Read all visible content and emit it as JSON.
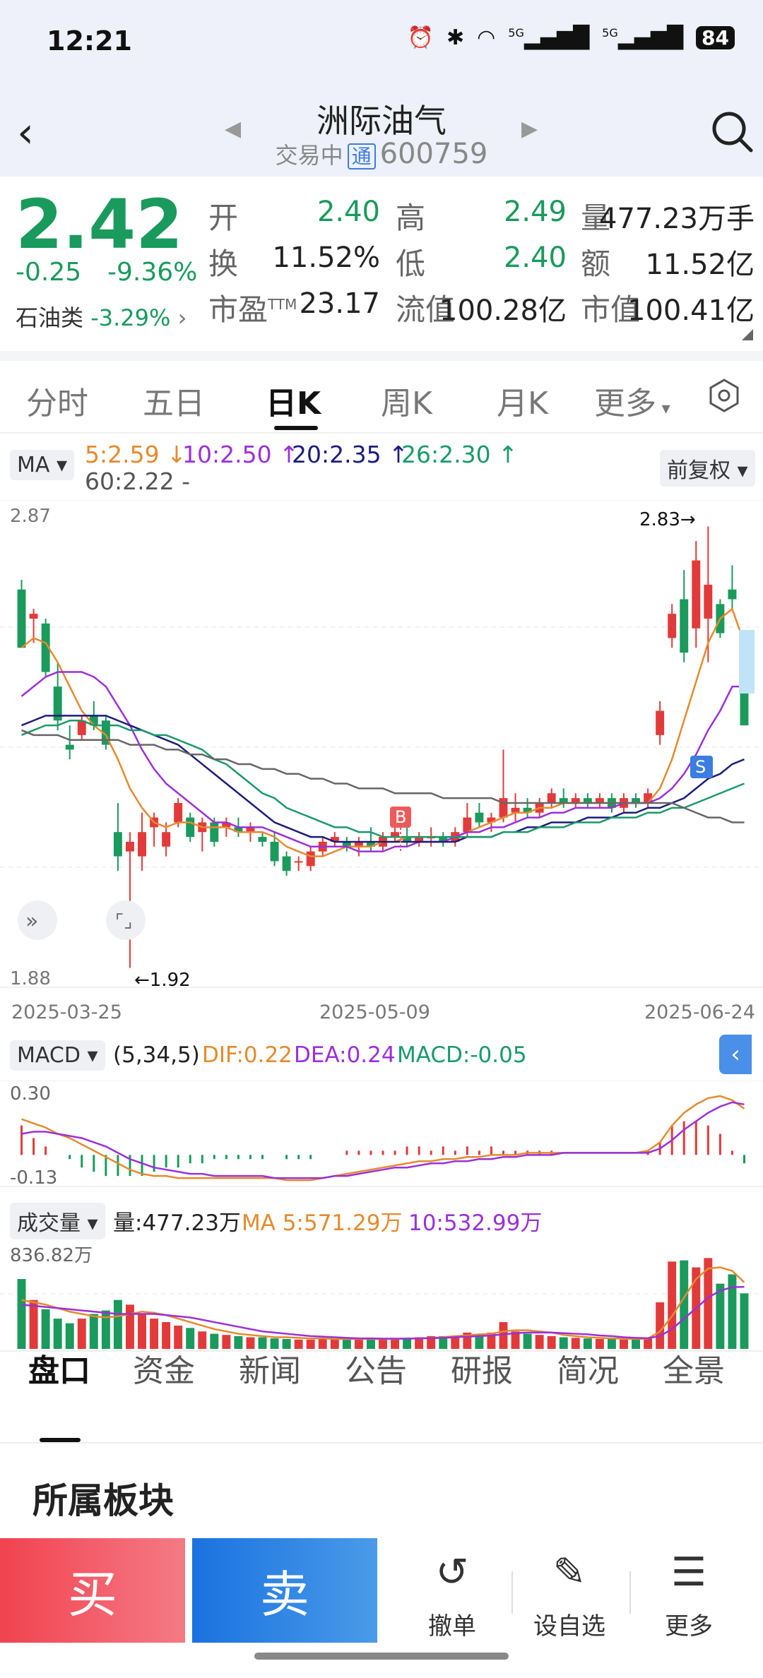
{
  "status_bar": {
    "time": "12:21",
    "battery": "84",
    "net1": "5G",
    "net2": "5G"
  },
  "header": {
    "title": "洲际油气",
    "trading_status": "交易中",
    "tong_badge": "通",
    "code": "600759"
  },
  "quote": {
    "price": "2.42",
    "change": "-0.25",
    "change_pct": "-9.36%",
    "sector_name": "石油类",
    "sector_pct": "-3.29%",
    "fields": [
      {
        "label": "开",
        "value": "2.40",
        "color": "green"
      },
      {
        "label": "高",
        "value": "2.49",
        "color": "green"
      },
      {
        "label": "量",
        "value": "477.23万手",
        "color": "dark"
      },
      {
        "label": "换",
        "value": "11.52%",
        "color": "dark"
      },
      {
        "label": "低",
        "value": "2.40",
        "color": "green"
      },
      {
        "label": "额",
        "value": "11.52亿",
        "color": "dark"
      },
      {
        "label": "市盈TTM",
        "value": "23.17",
        "color": "dark"
      },
      {
        "label": "流值",
        "value": "100.28亿",
        "color": "dark"
      },
      {
        "label": "市值",
        "value": "100.41亿",
        "color": "dark"
      }
    ]
  },
  "chart_tabs": [
    "分时",
    "五日",
    "日K",
    "周K",
    "月K",
    "更多"
  ],
  "chart_tabs_active": 2,
  "ma_legend": {
    "selector": "MA",
    "items": [
      {
        "text": "5:2.59 ↓",
        "color": "#e58a2e"
      },
      {
        "text": "10:2.50 ↑",
        "color": "#9b30d9"
      },
      {
        "text": "20:2.35 ↑",
        "color": "#1b1e7a"
      },
      {
        "text": "26:2.30 ↑",
        "color": "#1a9a6a"
      },
      {
        "text": "60:2.22 -",
        "color": "#555555"
      }
    ],
    "adjust": "前复权"
  },
  "kline_axis": {
    "top": "2.87",
    "bottom": "1.88",
    "high_label": "2.83→",
    "low_label": "←1.92",
    "dates": [
      "2025-03-25",
      "2025-05-09",
      "2025-06-24"
    ],
    "buy_marker": "B",
    "sell_marker": "S"
  },
  "macd": {
    "selector": "MACD",
    "params": "(5,34,5)",
    "dif": "DIF:0.22",
    "dea": "DEA:0.24",
    "macd": "MACD:-0.05",
    "top": "0.30",
    "bottom": "-0.13"
  },
  "volume": {
    "selector": "成交量",
    "vol": "量:477.23万",
    "ma5": "MA 5:571.29万",
    "ma10": "10:532.99万",
    "top": "836.82万"
  },
  "colors": {
    "up": "#e23a3a",
    "down": "#1a9a5c",
    "ma5": "#e58a2e",
    "ma10": "#9b30d9",
    "ma20": "#1b1e7a",
    "ma26": "#1a9a6a",
    "ma60": "#666666"
  },
  "chart_data": {
    "type": "candlestick",
    "x_range": [
      "2025-03-25",
      "2025-06-24"
    ],
    "ylim": [
      1.88,
      2.87
    ],
    "candles": [
      {
        "o": 2.7,
        "h": 2.72,
        "l": 2.58,
        "c": 2.58
      },
      {
        "o": 2.64,
        "h": 2.66,
        "l": 2.59,
        "c": 2.65
      },
      {
        "o": 2.63,
        "h": 2.64,
        "l": 2.52,
        "c": 2.53
      },
      {
        "o": 2.5,
        "h": 2.55,
        "l": 2.41,
        "c": 2.43
      },
      {
        "o": 2.38,
        "h": 2.42,
        "l": 2.35,
        "c": 2.37
      },
      {
        "o": 2.4,
        "h": 2.44,
        "l": 2.39,
        "c": 2.43
      },
      {
        "o": 2.44,
        "h": 2.47,
        "l": 2.41,
        "c": 2.42
      },
      {
        "o": 2.43,
        "h": 2.44,
        "l": 2.37,
        "c": 2.38
      },
      {
        "o": 2.2,
        "h": 2.26,
        "l": 2.12,
        "c": 2.15
      },
      {
        "o": 2.16,
        "h": 2.2,
        "l": 1.92,
        "c": 2.18
      },
      {
        "o": 2.15,
        "h": 2.24,
        "l": 2.12,
        "c": 2.2
      },
      {
        "o": 2.21,
        "h": 2.24,
        "l": 2.17,
        "c": 2.23
      },
      {
        "o": 2.17,
        "h": 2.22,
        "l": 2.15,
        "c": 2.2
      },
      {
        "o": 2.22,
        "h": 2.27,
        "l": 2.21,
        "c": 2.26
      },
      {
        "o": 2.23,
        "h": 2.24,
        "l": 2.18,
        "c": 2.19
      },
      {
        "o": 2.2,
        "h": 2.23,
        "l": 2.16,
        "c": 2.22
      },
      {
        "o": 2.22,
        "h": 2.23,
        "l": 2.17,
        "c": 2.18
      },
      {
        "o": 2.21,
        "h": 2.23,
        "l": 2.19,
        "c": 2.22
      },
      {
        "o": 2.21,
        "h": 2.23,
        "l": 2.19,
        "c": 2.2
      },
      {
        "o": 2.2,
        "h": 2.22,
        "l": 2.18,
        "c": 2.21
      },
      {
        "o": 2.19,
        "h": 2.2,
        "l": 2.17,
        "c": 2.18
      },
      {
        "o": 2.18,
        "h": 2.2,
        "l": 2.13,
        "c": 2.14
      },
      {
        "o": 2.15,
        "h": 2.16,
        "l": 2.11,
        "c": 2.12
      },
      {
        "o": 2.14,
        "h": 2.15,
        "l": 2.12,
        "c": 2.14
      },
      {
        "o": 2.13,
        "h": 2.17,
        "l": 2.12,
        "c": 2.16
      },
      {
        "o": 2.16,
        "h": 2.19,
        "l": 2.15,
        "c": 2.18
      },
      {
        "o": 2.18,
        "h": 2.2,
        "l": 2.17,
        "c": 2.19
      },
      {
        "o": 2.18,
        "h": 2.19,
        "l": 2.16,
        "c": 2.17
      },
      {
        "o": 2.17,
        "h": 2.19,
        "l": 2.15,
        "c": 2.18
      },
      {
        "o": 2.18,
        "h": 2.21,
        "l": 2.16,
        "c": 2.17
      },
      {
        "o": 2.17,
        "h": 2.2,
        "l": 2.16,
        "c": 2.19
      },
      {
        "o": 2.19,
        "h": 2.21,
        "l": 2.18,
        "c": 2.2
      },
      {
        "o": 2.19,
        "h": 2.21,
        "l": 2.17,
        "c": 2.18
      },
      {
        "o": 2.18,
        "h": 2.2,
        "l": 2.17,
        "c": 2.19
      },
      {
        "o": 2.19,
        "h": 2.21,
        "l": 2.17,
        "c": 2.19
      },
      {
        "o": 2.19,
        "h": 2.2,
        "l": 2.17,
        "c": 2.18
      },
      {
        "o": 2.18,
        "h": 2.21,
        "l": 2.17,
        "c": 2.2
      },
      {
        "o": 2.2,
        "h": 2.26,
        "l": 2.19,
        "c": 2.23
      },
      {
        "o": 2.24,
        "h": 2.26,
        "l": 2.21,
        "c": 2.22
      },
      {
        "o": 2.22,
        "h": 2.24,
        "l": 2.2,
        "c": 2.23
      },
      {
        "o": 2.23,
        "h": 2.37,
        "l": 2.22,
        "c": 2.27
      },
      {
        "o": 2.24,
        "h": 2.28,
        "l": 2.22,
        "c": 2.25
      },
      {
        "o": 2.25,
        "h": 2.27,
        "l": 2.23,
        "c": 2.24
      },
      {
        "o": 2.24,
        "h": 2.27,
        "l": 2.23,
        "c": 2.26
      },
      {
        "o": 2.26,
        "h": 2.29,
        "l": 2.25,
        "c": 2.28
      },
      {
        "o": 2.27,
        "h": 2.29,
        "l": 2.25,
        "c": 2.26
      },
      {
        "o": 2.26,
        "h": 2.28,
        "l": 2.25,
        "c": 2.27
      },
      {
        "o": 2.27,
        "h": 2.28,
        "l": 2.25,
        "c": 2.26
      },
      {
        "o": 2.26,
        "h": 2.28,
        "l": 2.25,
        "c": 2.27
      },
      {
        "o": 2.27,
        "h": 2.28,
        "l": 2.24,
        "c": 2.25
      },
      {
        "o": 2.25,
        "h": 2.28,
        "l": 2.24,
        "c": 2.27
      },
      {
        "o": 2.27,
        "h": 2.28,
        "l": 2.25,
        "c": 2.26
      },
      {
        "o": 2.26,
        "h": 2.29,
        "l": 2.25,
        "c": 2.28
      },
      {
        "o": 2.4,
        "h": 2.47,
        "l": 2.38,
        "c": 2.45
      },
      {
        "o": 2.6,
        "h": 2.67,
        "l": 2.58,
        "c": 2.65
      },
      {
        "o": 2.68,
        "h": 2.74,
        "l": 2.55,
        "c": 2.57
      },
      {
        "o": 2.62,
        "h": 2.8,
        "l": 2.58,
        "c": 2.76
      },
      {
        "o": 2.64,
        "h": 2.83,
        "l": 2.55,
        "c": 2.71
      },
      {
        "o": 2.67,
        "h": 2.68,
        "l": 2.6,
        "c": 2.61
      },
      {
        "o": 2.7,
        "h": 2.75,
        "l": 2.66,
        "c": 2.68
      },
      {
        "o": 2.49,
        "h": 2.55,
        "l": 2.42,
        "c": 2.42
      }
    ],
    "ma_lines": [
      {
        "name": "MA5",
        "values": [
          2.58,
          2.6,
          2.59,
          2.55,
          2.5,
          2.45,
          2.42,
          2.4,
          2.35,
          2.29,
          2.25,
          2.22,
          2.21,
          2.22,
          2.22,
          2.21,
          2.21,
          2.21,
          2.2,
          2.2,
          2.2,
          2.19,
          2.17,
          2.16,
          2.15,
          2.15,
          2.16,
          2.17,
          2.17,
          2.17,
          2.18,
          2.18,
          2.19,
          2.19,
          2.19,
          2.19,
          2.19,
          2.2,
          2.21,
          2.22,
          2.23,
          2.24,
          2.24,
          2.25,
          2.25,
          2.26,
          2.26,
          2.26,
          2.26,
          2.26,
          2.26,
          2.26,
          2.26,
          2.29,
          2.35,
          2.43,
          2.51,
          2.59,
          2.64,
          2.66,
          2.59
        ]
      },
      {
        "name": "MA10",
        "values": [
          2.48,
          2.5,
          2.52,
          2.53,
          2.53,
          2.53,
          2.52,
          2.5,
          2.46,
          2.42,
          2.37,
          2.33,
          2.3,
          2.28,
          2.26,
          2.24,
          2.22,
          2.22,
          2.21,
          2.21,
          2.21,
          2.2,
          2.19,
          2.18,
          2.17,
          2.17,
          2.17,
          2.17,
          2.16,
          2.16,
          2.16,
          2.17,
          2.17,
          2.18,
          2.18,
          2.18,
          2.19,
          2.2,
          2.2,
          2.21,
          2.21,
          2.22,
          2.23,
          2.23,
          2.24,
          2.24,
          2.25,
          2.25,
          2.25,
          2.25,
          2.26,
          2.26,
          2.26,
          2.27,
          2.29,
          2.32,
          2.36,
          2.41,
          2.45,
          2.5,
          2.5
        ]
      },
      {
        "name": "MA20",
        "values": [
          2.42,
          2.43,
          2.44,
          2.44,
          2.44,
          2.44,
          2.44,
          2.44,
          2.43,
          2.42,
          2.41,
          2.4,
          2.39,
          2.38,
          2.36,
          2.34,
          2.32,
          2.3,
          2.28,
          2.26,
          2.24,
          2.22,
          2.21,
          2.2,
          2.19,
          2.19,
          2.18,
          2.18,
          2.18,
          2.18,
          2.18,
          2.18,
          2.18,
          2.18,
          2.18,
          2.18,
          2.18,
          2.19,
          2.19,
          2.19,
          2.2,
          2.2,
          2.21,
          2.21,
          2.22,
          2.22,
          2.22,
          2.23,
          2.23,
          2.23,
          2.24,
          2.24,
          2.25,
          2.25,
          2.26,
          2.27,
          2.29,
          2.31,
          2.32,
          2.34,
          2.35
        ]
      },
      {
        "name": "MA26",
        "values": [
          2.4,
          2.41,
          2.42,
          2.42,
          2.43,
          2.43,
          2.42,
          2.42,
          2.42,
          2.41,
          2.41,
          2.4,
          2.4,
          2.39,
          2.38,
          2.37,
          2.35,
          2.34,
          2.32,
          2.3,
          2.28,
          2.27,
          2.25,
          2.24,
          2.23,
          2.22,
          2.21,
          2.21,
          2.2,
          2.2,
          2.19,
          2.19,
          2.19,
          2.19,
          2.19,
          2.19,
          2.19,
          2.19,
          2.19,
          2.19,
          2.2,
          2.2,
          2.2,
          2.21,
          2.21,
          2.21,
          2.22,
          2.22,
          2.22,
          2.23,
          2.23,
          2.23,
          2.24,
          2.24,
          2.25,
          2.25,
          2.26,
          2.27,
          2.28,
          2.29,
          2.3
        ]
      },
      {
        "name": "MA60",
        "values": [
          2.41,
          2.4,
          2.4,
          2.4,
          2.39,
          2.39,
          2.39,
          2.39,
          2.39,
          2.38,
          2.38,
          2.38,
          2.37,
          2.37,
          2.36,
          2.36,
          2.35,
          2.35,
          2.34,
          2.34,
          2.33,
          2.33,
          2.32,
          2.32,
          2.31,
          2.31,
          2.3,
          2.3,
          2.29,
          2.29,
          2.29,
          2.28,
          2.28,
          2.28,
          2.28,
          2.27,
          2.27,
          2.27,
          2.27,
          2.27,
          2.26,
          2.26,
          2.26,
          2.26,
          2.26,
          2.26,
          2.26,
          2.26,
          2.26,
          2.26,
          2.26,
          2.26,
          2.26,
          2.26,
          2.26,
          2.25,
          2.24,
          2.23,
          2.23,
          2.22,
          2.22
        ]
      }
    ],
    "macd": {
      "dif": [
        0.17,
        0.15,
        0.13,
        0.1,
        0.08,
        0.05,
        0.02,
        -0.01,
        -0.04,
        -0.07,
        -0.09,
        -0.1,
        -0.1,
        -0.11,
        -0.11,
        -0.11,
        -0.11,
        -0.11,
        -0.11,
        -0.11,
        -0.11,
        -0.11,
        -0.12,
        -0.12,
        -0.12,
        -0.11,
        -0.1,
        -0.09,
        -0.08,
        -0.07,
        -0.06,
        -0.05,
        -0.04,
        -0.03,
        -0.03,
        -0.02,
        -0.02,
        -0.01,
        -0.01,
        0.0,
        0.0,
        0.0,
        0.01,
        0.01,
        0.01,
        0.01,
        0.01,
        0.01,
        0.01,
        0.01,
        0.01,
        0.01,
        0.02,
        0.06,
        0.14,
        0.2,
        0.24,
        0.27,
        0.28,
        0.26,
        0.22
      ],
      "dea": [
        0.1,
        0.11,
        0.11,
        0.1,
        0.09,
        0.08,
        0.06,
        0.04,
        0.01,
        -0.02,
        -0.04,
        -0.06,
        -0.07,
        -0.08,
        -0.09,
        -0.09,
        -0.1,
        -0.1,
        -0.1,
        -0.1,
        -0.1,
        -0.11,
        -0.11,
        -0.11,
        -0.11,
        -0.11,
        -0.1,
        -0.1,
        -0.09,
        -0.08,
        -0.07,
        -0.06,
        -0.06,
        -0.05,
        -0.04,
        -0.04,
        -0.03,
        -0.03,
        -0.02,
        -0.02,
        -0.01,
        -0.01,
        0.0,
        0.0,
        0.0,
        0.01,
        0.01,
        0.01,
        0.01,
        0.01,
        0.01,
        0.01,
        0.01,
        0.03,
        0.07,
        0.12,
        0.16,
        0.2,
        0.23,
        0.25,
        0.24
      ]
    },
    "volume": {
      "ylim": [
        0,
        836.82
      ],
      "values": [
        600,
        420,
        340,
        260,
        220,
        260,
        300,
        330,
        420,
        380,
        300,
        260,
        230,
        200,
        180,
        150,
        130,
        120,
        110,
        100,
        100,
        90,
        85,
        80,
        80,
        85,
        90,
        85,
        80,
        80,
        85,
        90,
        95,
        100,
        110,
        110,
        115,
        140,
        130,
        140,
        230,
        150,
        130,
        120,
        110,
        100,
        95,
        90,
        85,
        85,
        80,
        85,
        90,
        400,
        750,
        760,
        700,
        780,
        560,
        640,
        477
      ],
      "ma5": [
        420,
        400,
        380,
        350,
        320,
        300,
        280,
        270,
        280,
        300,
        320,
        310,
        290,
        260,
        230,
        200,
        170,
        150,
        130,
        120,
        110,
        100,
        100,
        95,
        90,
        90,
        85,
        85,
        85,
        85,
        85,
        85,
        90,
        90,
        95,
        100,
        110,
        115,
        125,
        130,
        150,
        160,
        160,
        150,
        140,
        120,
        110,
        100,
        95,
        90,
        88,
        86,
        88,
        150,
        280,
        440,
        600,
        690,
        700,
        670,
        571
      ],
      "ma10": [
        380,
        370,
        360,
        350,
        340,
        330,
        320,
        310,
        300,
        300,
        300,
        300,
        290,
        280,
        270,
        250,
        230,
        210,
        190,
        170,
        150,
        140,
        130,
        120,
        110,
        105,
        100,
        95,
        90,
        90,
        88,
        88,
        88,
        90,
        92,
        95,
        100,
        105,
        110,
        115,
        125,
        135,
        140,
        140,
        140,
        135,
        130,
        125,
        115,
        110,
        100,
        95,
        92,
        110,
        170,
        260,
        350,
        440,
        500,
        530,
        533
      ]
    }
  }
}
